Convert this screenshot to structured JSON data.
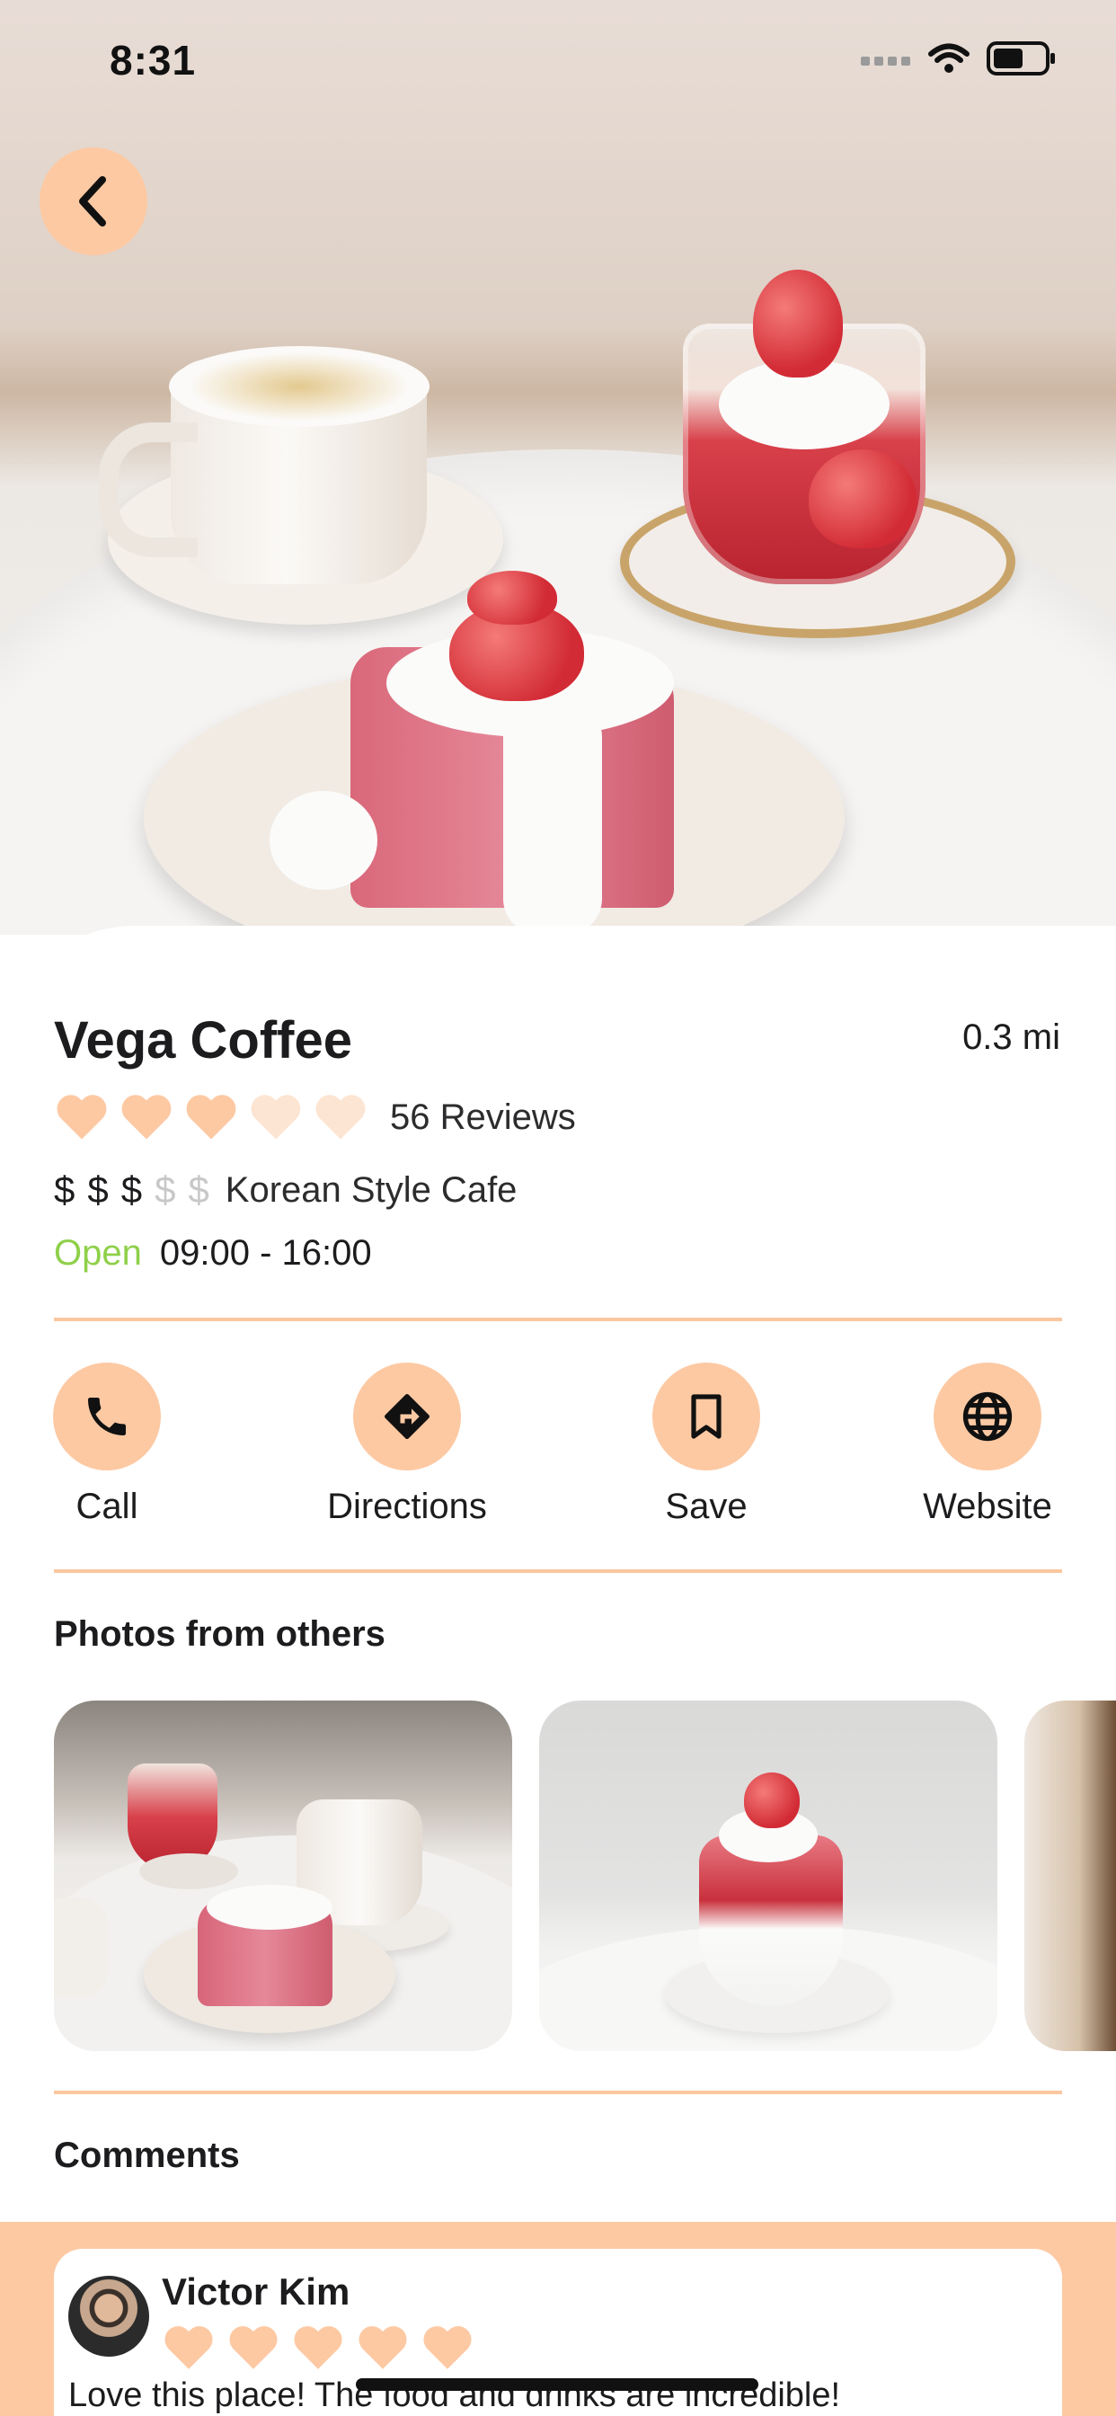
{
  "status_bar": {
    "time": "8:31"
  },
  "place": {
    "name": "Vega Coffee",
    "distance": "0.3 mi",
    "rating": 3,
    "rating_max": 5,
    "reviews": "56 Reviews",
    "price_level": 3,
    "price_max": 5,
    "price_symbol": "$",
    "category": "Korean Style Cafe",
    "open_status": "Open",
    "hours": "09:00 - 16:00"
  },
  "actions": {
    "call": "Call",
    "directions": "Directions",
    "save": "Save",
    "website": "Website"
  },
  "photos_section": {
    "title": "Photos from others"
  },
  "comments_section": {
    "title": "Comments",
    "items": [
      {
        "author": "Victor Kim",
        "rating": 5,
        "text": "Love this place! The food and drinks are incredible!"
      }
    ]
  },
  "colors": {
    "accent": "#fdc9a3",
    "heart_filled": "#fdc9a3",
    "heart_empty": "#fde5d3",
    "open": "#8fd04a",
    "divider": "#fbc79f"
  },
  "icons": {
    "back": "chevron-left-icon",
    "call": "phone-icon",
    "directions": "directions-icon",
    "save": "bookmark-icon",
    "website": "globe-icon"
  }
}
